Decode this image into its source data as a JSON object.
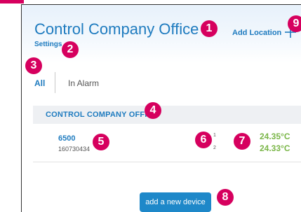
{
  "header": {
    "title": "Control Company Office",
    "settings_link": "Settings",
    "add_location_label": "Add Location"
  },
  "tabs": [
    {
      "label": "All",
      "active": true
    },
    {
      "label": "In Alarm",
      "active": false
    }
  ],
  "location": {
    "name": "CONTROL COMPANY OFFICE",
    "devices": [
      {
        "name": "6500",
        "serial": "160730434",
        "channels": [
          {
            "number": "1",
            "temperature": "24.35°C"
          },
          {
            "number": "2",
            "temperature": "24.33°C"
          }
        ]
      }
    ]
  },
  "actions": {
    "add_device_label": "add a new device"
  },
  "callouts": [
    "1",
    "2",
    "3",
    "4",
    "5",
    "6",
    "7",
    "8",
    "9"
  ],
  "colors": {
    "accent": "#1e7bbf",
    "button": "#1e88c9",
    "temperature": "#7ab648",
    "callout": "#d6005e",
    "location_bar": "#eef0f3"
  },
  "icons": {
    "add_location": "plus-icon"
  }
}
